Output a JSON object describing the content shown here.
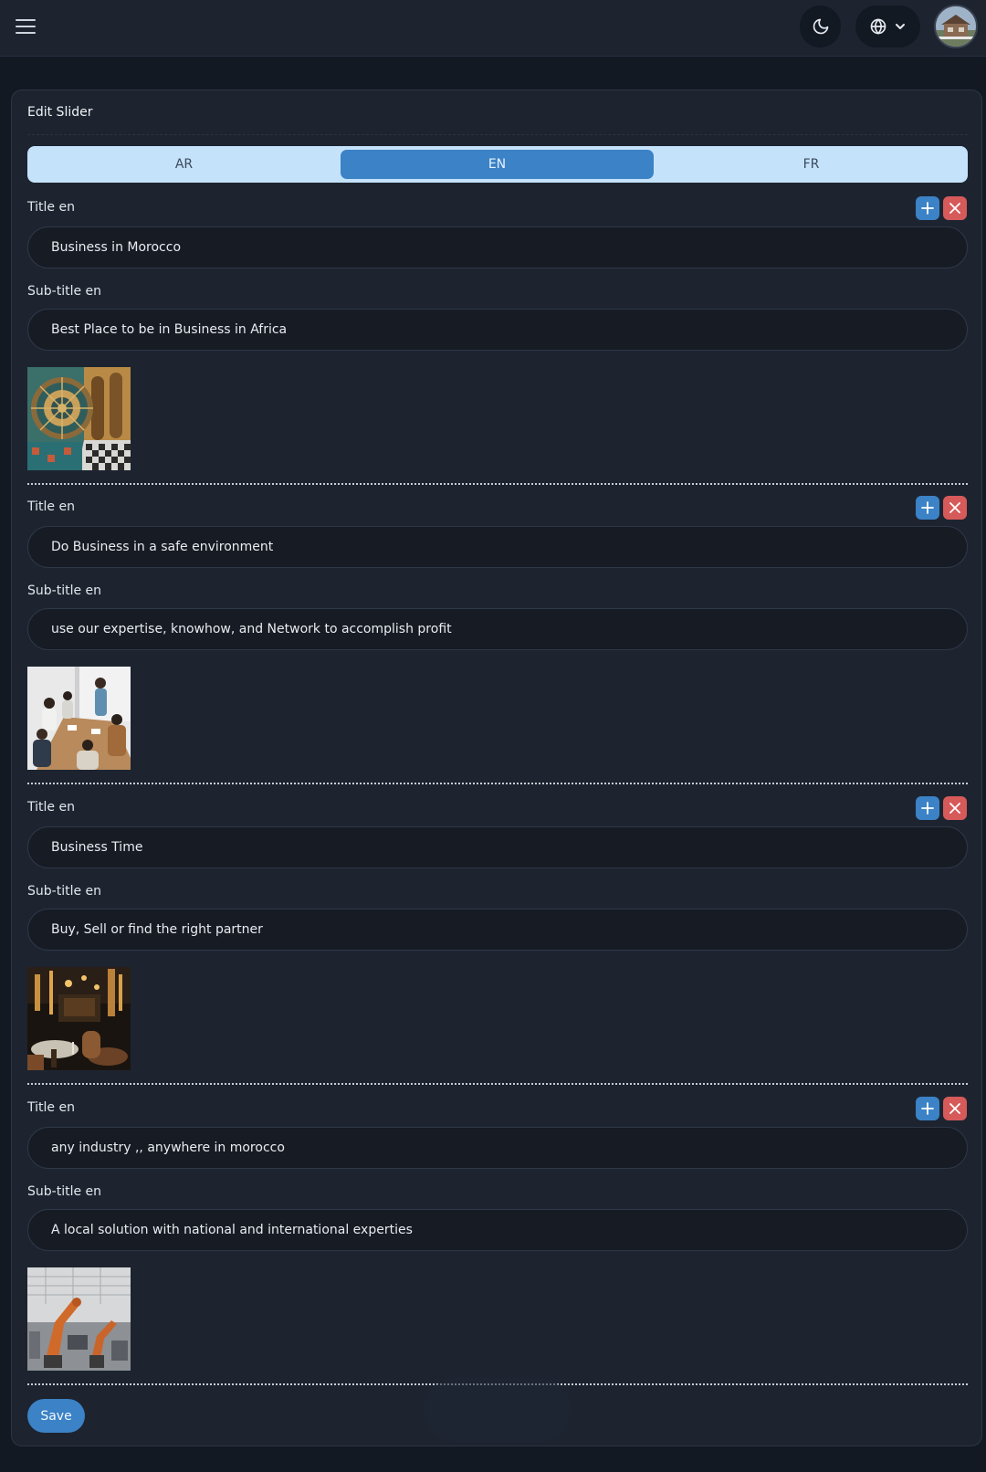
{
  "colors": {
    "background": "#131923",
    "card": "#1d2430",
    "accent": "#3b82c6",
    "danger": "#d65a5a",
    "tabs_bg": "#c5e2fb"
  },
  "topbar": {
    "menu_icon": "hamburger-icon",
    "theme_icon": "moon-icon",
    "language_icon": "globe-icon",
    "language_caret": "chevron-down-icon"
  },
  "card": {
    "title": "Edit Slider",
    "tabs": [
      {
        "label": "AR",
        "active": false
      },
      {
        "label": "EN",
        "active": true
      },
      {
        "label": "FR",
        "active": false
      }
    ],
    "slides": [
      {
        "title_label": "Title en",
        "title_value": "Business in Morocco",
        "subtitle_label": "Sub-title en",
        "subtitle_value": "Best Place to be in Business in Africa",
        "image_alt": "Moroccan zellige and arches"
      },
      {
        "title_label": "Title en",
        "title_value": "Do Business in a safe environment",
        "subtitle_label": "Sub-title en",
        "subtitle_value": "use our expertise, knowhow, and Network to accomplish profit",
        "image_alt": "Business team meeting"
      },
      {
        "title_label": "Title en",
        "title_value": "Business Time",
        "subtitle_label": "Sub-title en",
        "subtitle_value": "Buy, Sell or find the right partner",
        "image_alt": "Restaurant interior"
      },
      {
        "title_label": "Title en",
        "title_value": "any industry ,, anywhere in morocco",
        "subtitle_label": "Sub-title en",
        "subtitle_value": "A local solution with national and international experties",
        "image_alt": "Industrial robots"
      }
    ],
    "save_label": "Save"
  }
}
